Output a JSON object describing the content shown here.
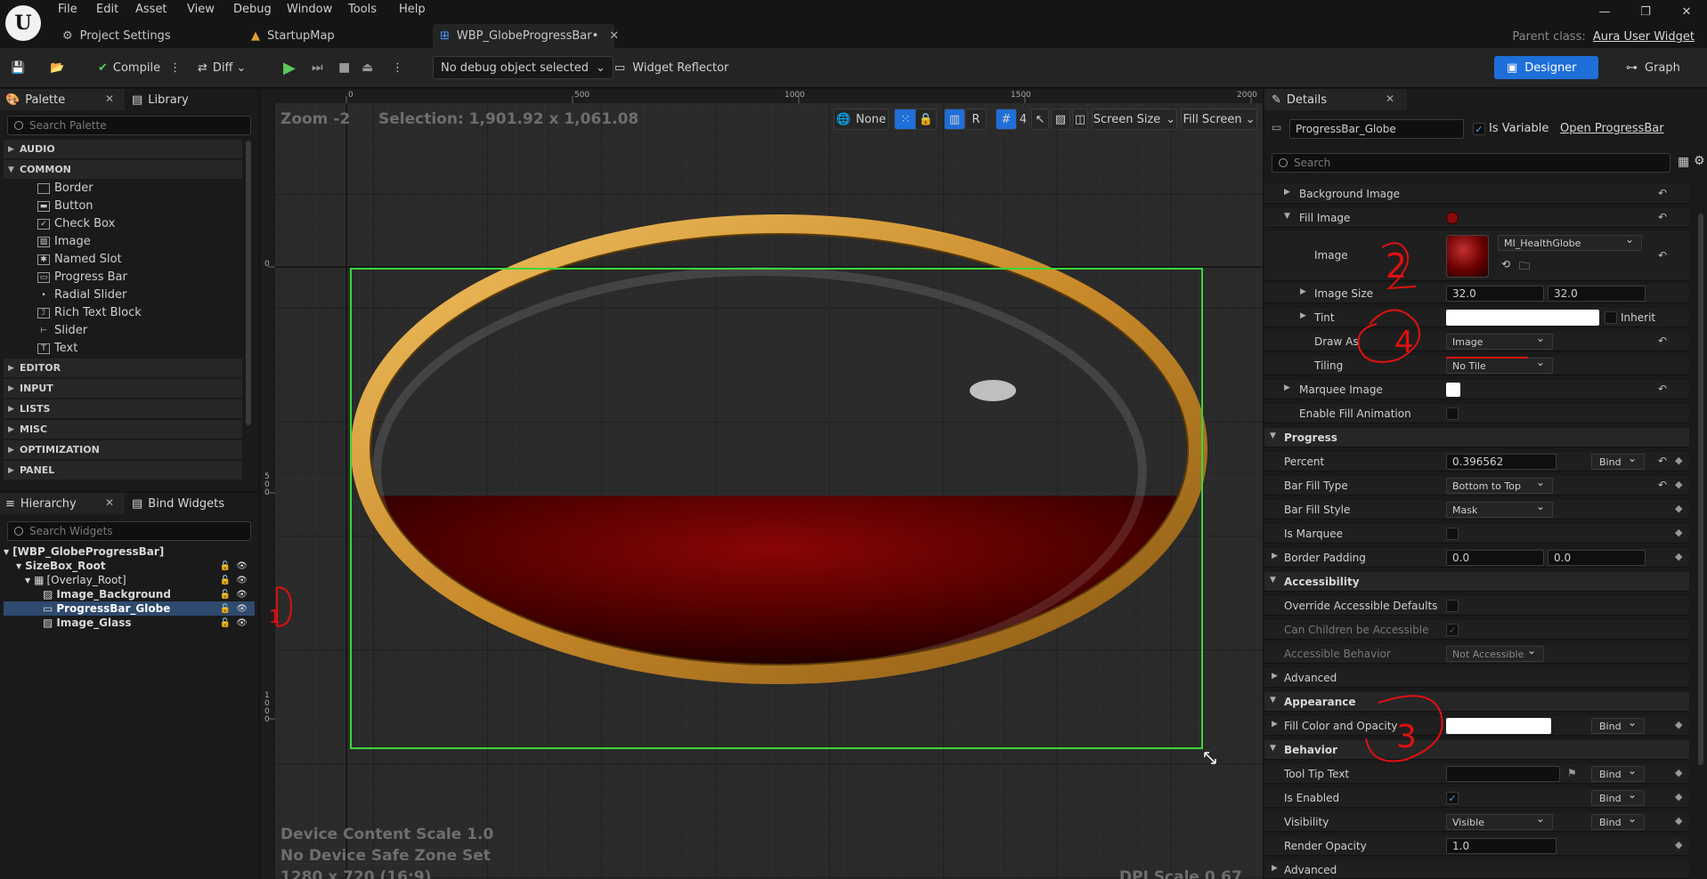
{
  "menu": [
    "File",
    "Edit",
    "Asset",
    "View",
    "Debug",
    "Window",
    "Tools",
    "Help"
  ],
  "tabs": {
    "project_settings": "Project Settings",
    "startup_map": "StartupMap",
    "active": "WBP_GlobeProgressBar•"
  },
  "parent_class": {
    "label": "Parent class:",
    "value": "Aura User Widget"
  },
  "toolbar": {
    "compile": "Compile",
    "diff": "Diff",
    "debug_object": "No debug object selected",
    "widget_reflector": "Widget Reflector",
    "designer": "Designer",
    "graph": "Graph"
  },
  "palette": {
    "tab": "Palette",
    "library_tab": "Library",
    "search_placeholder": "Search Palette",
    "categories": {
      "audio": "AUDIO",
      "common": "COMMON",
      "editor": "EDITOR",
      "input": "INPUT",
      "lists": "LISTS",
      "misc": "MISC",
      "optimization": "OPTIMIZATION",
      "panel": "PANEL"
    },
    "items": [
      "Border",
      "Button",
      "Check Box",
      "Image",
      "Named Slot",
      "Progress Bar",
      "Radial Slider",
      "Rich Text Block",
      "Slider",
      "Text"
    ]
  },
  "hierarchy": {
    "tab": "Hierarchy",
    "bind_tab": "Bind Widgets",
    "search_placeholder": "Search Widgets",
    "rows": [
      "[WBP_GlobeProgressBar]",
      "SizeBox_Root",
      "[Overlay_Root]",
      "Image_Background",
      "ProgressBar_Globe",
      "Image_Glass"
    ]
  },
  "canvas": {
    "zoom": "Zoom -2",
    "selection": "Selection: 1,901.92 x 1,061.08",
    "none_btn": "None",
    "r_btn": "R",
    "grid_num": "4",
    "screen_size": "Screen Size",
    "fill_screen": "Fill Screen",
    "ruler_top": [
      "0",
      "500",
      "1000",
      "1500",
      "2000"
    ],
    "ruler_left": [
      "0",
      "5\n0\n0",
      "1\n0\n0\n0"
    ],
    "device_scale": "Device Content Scale 1.0",
    "safe_zone": "No Device Safe Zone Set",
    "resolution": "1280 x 720 (16:9)",
    "dpi": "DPI Scale 0.67",
    "progress_percent": 0.396562
  },
  "details": {
    "tab": "Details",
    "name_value": "ProgressBar_Globe",
    "is_variable": "Is Variable",
    "open_link": "Open ProgressBar",
    "search_placeholder": "Search",
    "rows": {
      "background_image": "Background Image",
      "fill_image": "Fill Image",
      "image": "Image",
      "image_asset": "MI_HealthGlobe",
      "image_size": "Image Size",
      "size_x": "32.0",
      "size_y": "32.0",
      "tint": "Tint",
      "inherit": "Inherit",
      "draw_as": "Draw As",
      "draw_as_value": "Image",
      "tiling": "Tiling",
      "tiling_value": "No Tile",
      "marquee_image": "Marquee Image",
      "enable_fill_anim": "Enable Fill Animation",
      "progress_section": "Progress",
      "percent": "Percent",
      "percent_value": "0.396562",
      "bind": "Bind",
      "bar_fill_type": "Bar Fill Type",
      "bar_fill_type_value": "Bottom to Top",
      "bar_fill_style": "Bar Fill Style",
      "bar_fill_style_value": "Mask",
      "is_marquee": "Is Marquee",
      "border_padding": "Border Padding",
      "pad_x": "0.0",
      "pad_y": "0.0",
      "accessibility_section": "Accessibility",
      "override_access": "Override Accessible Defaults",
      "children_access": "Can Children be Accessible",
      "access_behavior": "Accessible Behavior",
      "access_behavior_value": "Not Accessible",
      "advanced": "Advanced",
      "appearance_section": "Appearance",
      "fill_color": "Fill Color and Opacity",
      "behavior_section": "Behavior",
      "tooltip": "Tool Tip Text",
      "is_enabled": "Is Enabled",
      "visibility": "Visibility",
      "visibility_value": "Visible",
      "render_opacity": "Render Opacity",
      "render_opacity_value": "1.0",
      "advanced2": "Advanced"
    }
  },
  "annotations": [
    "1",
    "2",
    "3",
    "4"
  ],
  "colors": {
    "accent": "#1e6fd9",
    "annotation": "#e01010",
    "fill_red": "#7a0000",
    "gold": "#d9a03a",
    "selection": "#39d739"
  }
}
